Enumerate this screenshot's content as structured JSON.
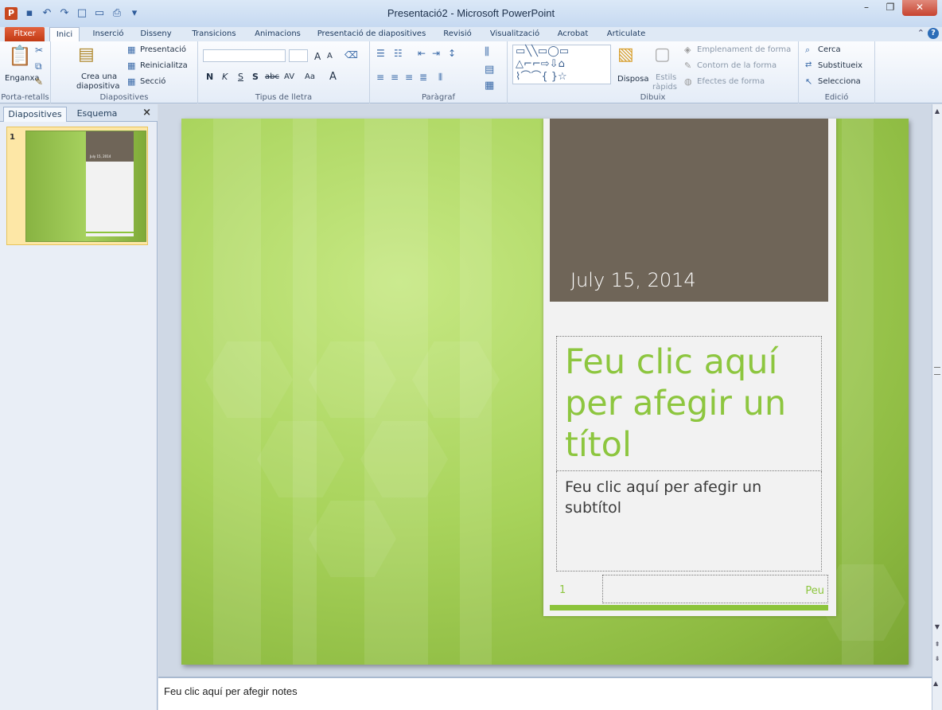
{
  "window": {
    "title": "Presentació2 - Microsoft PowerPoint",
    "app_icon": "P",
    "controls": [
      "–",
      "❐",
      "✕"
    ]
  },
  "ribbon_tabs": [
    "Fitxer",
    "Inici",
    "Inserció",
    "Disseny",
    "Transicions",
    "Animacions",
    "Presentació de diapositives",
    "Revisió",
    "Visualització",
    "Acrobat",
    "Articulate"
  ],
  "active_tab": "Inici",
  "ribbon": {
    "clipboard": {
      "paste_label": "Enganxa",
      "group_label": "Porta-retalls"
    },
    "slides": {
      "new_slide_line1": "Crea una",
      "new_slide_line2": "diapositiva",
      "layout": "Presentació",
      "reset": "Reinicialitza",
      "section": "Secció",
      "group_label": "Diapositives"
    },
    "font": {
      "bold": "N",
      "italic": "K",
      "underline": "S",
      "shadow": "S",
      "strike": "abc",
      "spacing": "AV",
      "case": "Aa",
      "color": "A",
      "grow": "A",
      "shrink": "A",
      "group_label": "Tipus de lletra"
    },
    "paragraph": {
      "group_label": "Paràgraf"
    },
    "drawing": {
      "arrange": "Disposa",
      "styles_line1": "Estils",
      "styles_line2": "ràpids",
      "fill": "Emplenament de forma",
      "outline": "Contorn de la forma",
      "effects": "Efectes de forma",
      "group_label": "Dibuix"
    },
    "editing": {
      "find": "Cerca",
      "replace": "Substitueix",
      "select": "Selecciona",
      "group_label": "Edició"
    }
  },
  "left_panel": {
    "tabs": [
      "Diapositives",
      "Esquema"
    ],
    "active_tab": "Diapositives",
    "close": "×",
    "slide_number": "1",
    "thumbnail_date": "July 15, 2014"
  },
  "slide": {
    "date": "July 15, 2014",
    "title_placeholder": "Feu clic aquí per afegir un títol",
    "subtitle_placeholder": "Feu clic aquí per afegir un subtítol",
    "slide_number": "1",
    "footer": "Peu"
  },
  "notes": {
    "placeholder": "Feu clic aquí per afegir notes"
  },
  "colors": {
    "accent_green": "#8dc63f",
    "card_top": "#6f6558",
    "file_tab": "#d24a22"
  }
}
